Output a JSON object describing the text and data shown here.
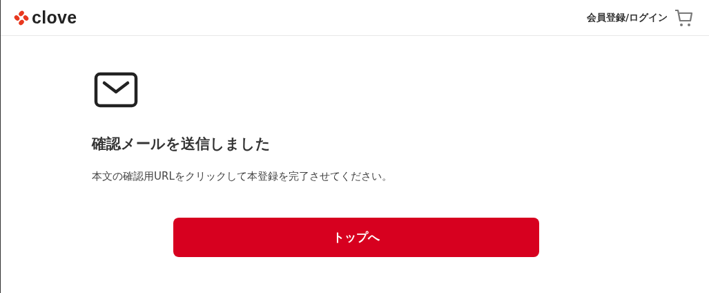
{
  "header": {
    "logo": "clove",
    "login_link": "会員登録/ログイン"
  },
  "message": {
    "title": "確認メールを送信しました",
    "body": "本文の確認用URLをクリックして本登録を完了させてください。"
  },
  "buttons": [
    {
      "label": "トップへ"
    }
  ]
}
